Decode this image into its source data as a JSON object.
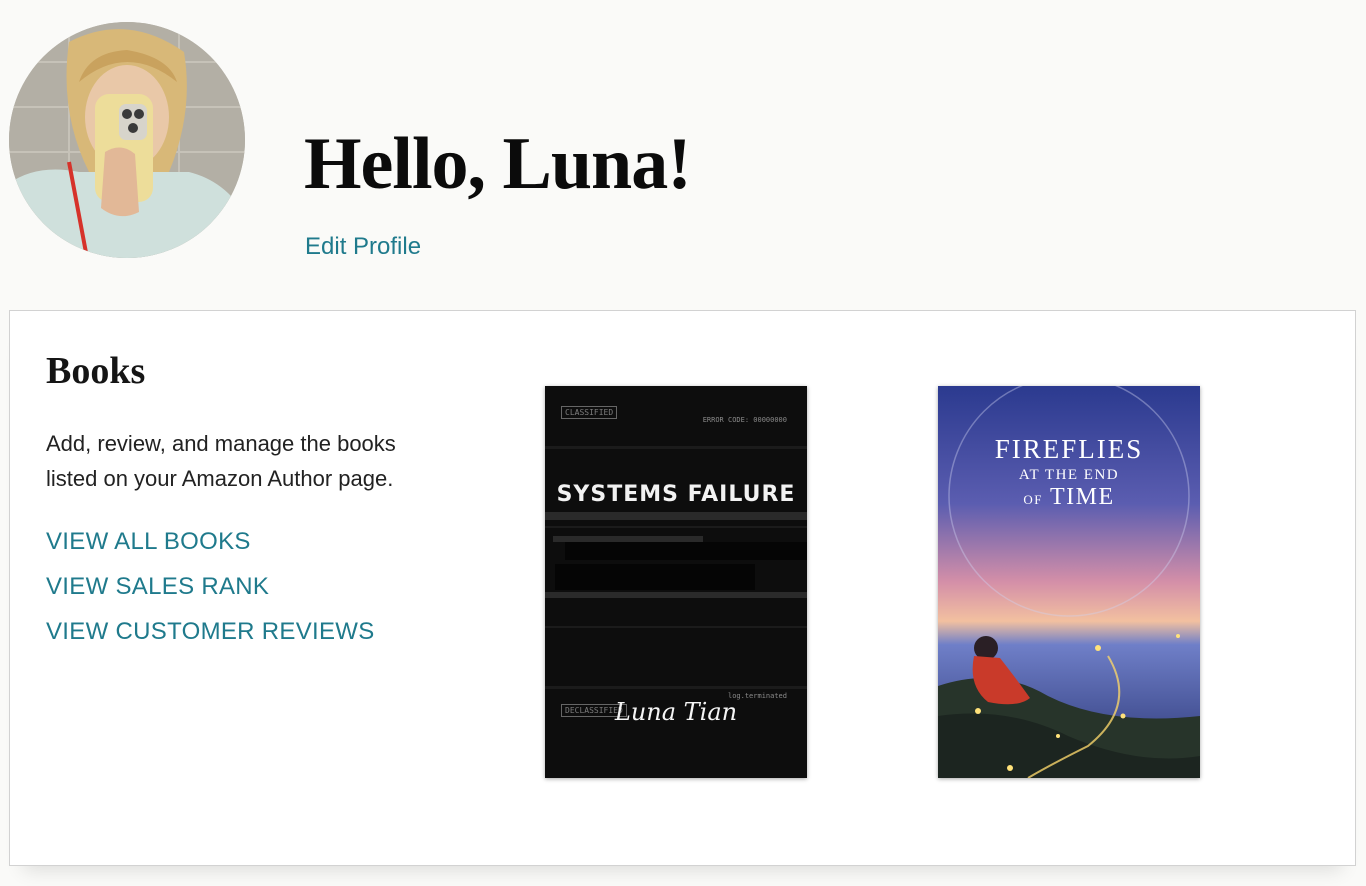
{
  "header": {
    "greeting": "Hello, Luna!",
    "edit_profile_label": "Edit Profile"
  },
  "avatar": {
    "icon": "profile-photo"
  },
  "books_card": {
    "title": "Books",
    "description": "Add, review, and manage the books listed on your Amazon Author page.",
    "links": [
      {
        "label": "VIEW ALL BOOKS"
      },
      {
        "label": "VIEW SALES RANK"
      },
      {
        "label": "VIEW CUSTOMER REVIEWS"
      }
    ],
    "covers": [
      {
        "title": "SYSTEMS FAILURE",
        "author": "Luna Tian",
        "stamp_top": "CLASSIFIED",
        "note_top": "ERROR CODE: 00000000",
        "stamp_bottom": "DECLASSIFIED",
        "note_bottom": "log.terminated"
      },
      {
        "title_line1": "FIREFLIES",
        "title_line2": "AT THE END",
        "title_line3_small": "OF",
        "title_line3_main": "TIME"
      }
    ]
  },
  "colors": {
    "page_bg": "#fafaf8",
    "link": "#1f7a8c",
    "card_border": "#d2d2d2",
    "title_accent_red": "#d6251f"
  }
}
